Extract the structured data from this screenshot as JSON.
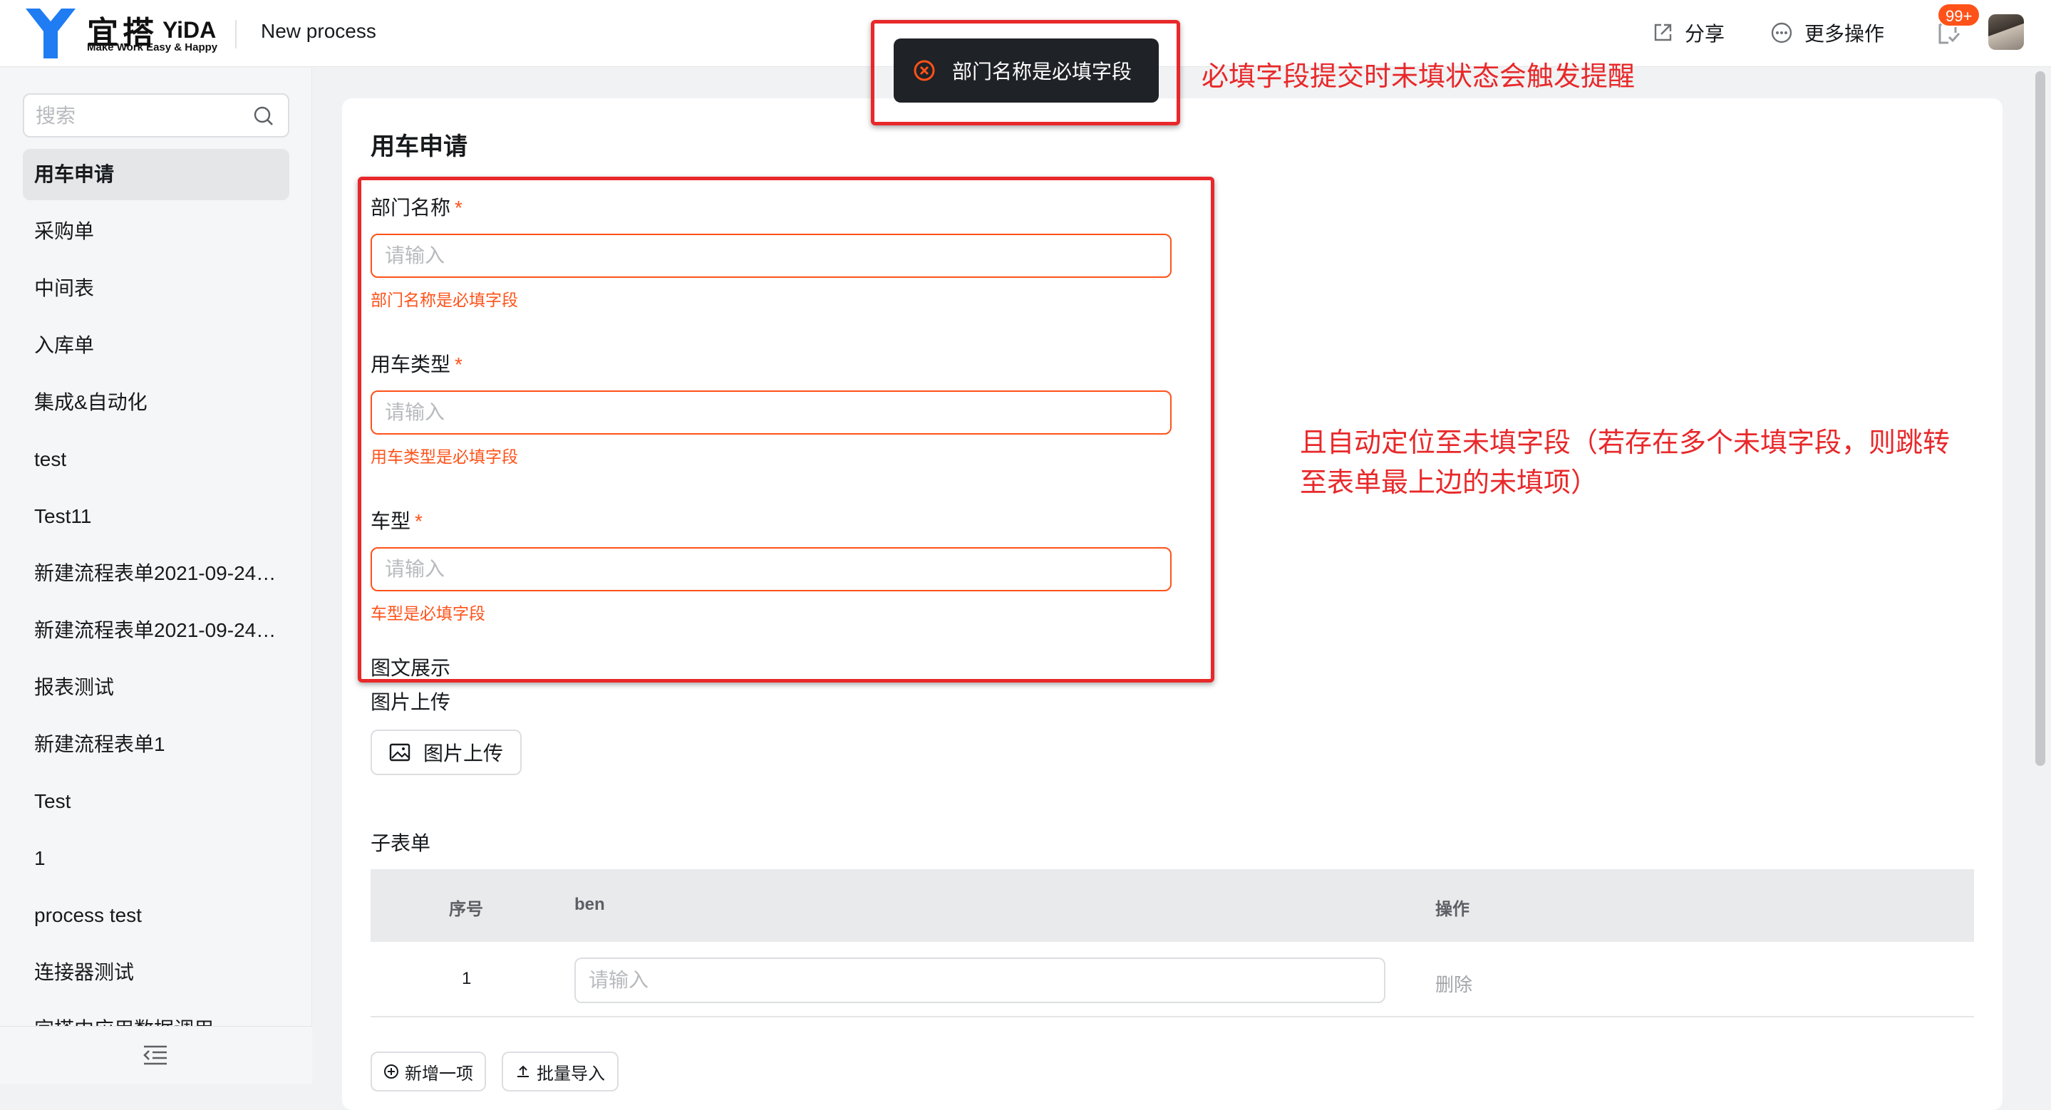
{
  "header": {
    "logo_cn": "宜搭",
    "logo_en": "YiDA",
    "logo_tagline": "Make Work Easy & Happy",
    "app_title": "New process",
    "share_label": "分享",
    "more_label": "更多操作",
    "todo_badge": "99+"
  },
  "sidebar": {
    "search_placeholder": "搜索",
    "items": [
      {
        "label": "用车申请",
        "active": true
      },
      {
        "label": "采购单"
      },
      {
        "label": "中间表"
      },
      {
        "label": "入库单"
      },
      {
        "label": "集成&自动化"
      },
      {
        "label": "test"
      },
      {
        "label": "Test11"
      },
      {
        "label": "新建流程表单2021-09-24…"
      },
      {
        "label": "新建流程表单2021-09-24…"
      },
      {
        "label": "报表测试"
      },
      {
        "label": "新建流程表单1"
      },
      {
        "label": "Test"
      },
      {
        "label": "1"
      },
      {
        "label": "process test"
      },
      {
        "label": "连接器测试"
      },
      {
        "label": "宜搭中应用数据调用"
      }
    ]
  },
  "form": {
    "title": "用车申请",
    "fields": [
      {
        "label": "部门名称",
        "required": "*",
        "placeholder": "请输入",
        "error": "部门名称是必填字段"
      },
      {
        "label": "用车类型",
        "required": "*",
        "placeholder": "请输入",
        "error": "用车类型是必填字段"
      },
      {
        "label": "车型",
        "required": "*",
        "placeholder": "请输入",
        "error": "车型是必填字段"
      }
    ],
    "richtext_label": "图文展示",
    "image_upload_label": "图片上传",
    "image_upload_button": "图片上传",
    "subform": {
      "label": "子表单",
      "columns": [
        "序号",
        "ben",
        "操作"
      ],
      "rows": [
        {
          "index": "1",
          "placeholder": "请输入",
          "action": "删除"
        }
      ],
      "add_button": "新增一项",
      "import_button": "批量导入"
    }
  },
  "toast": {
    "message": "部门名称是必填字段"
  },
  "annotations": {
    "toast_note": "必填字段提交时未填状态会触发提醒",
    "form_note": "且自动定位至未填字段（若存在多个未填字段，则跳转至表单最上边的未填项）"
  },
  "colors": {
    "accent_error": "#ff5219",
    "annotation_red": "#e8282a",
    "toast_bg": "#1f2226",
    "logo_blue": "#1f7cf2"
  }
}
